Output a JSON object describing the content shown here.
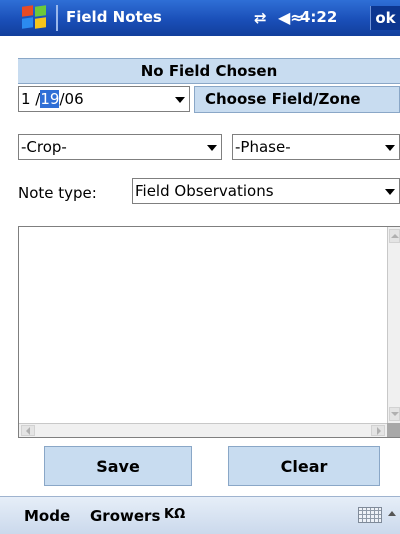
{
  "titlebar": {
    "app_title": "Field Notes",
    "connectivity_icon": "connectivity-icon",
    "volume_icon": "speaker-icon",
    "time": "4:22",
    "ok_label": "ok"
  },
  "header": {
    "field_name": "No Field Chosen"
  },
  "date": {
    "prefix": "1 /",
    "selected_day": "19",
    "suffix": "/06"
  },
  "choose_button": "Choose Field/Zone",
  "crop": {
    "value": "-Crop-"
  },
  "phase": {
    "value": "-Phase-"
  },
  "note_type": {
    "label": "Note type:",
    "value": "Field Observations"
  },
  "notes": {
    "text": ""
  },
  "buttons": {
    "save": "Save",
    "clear": "Clear"
  },
  "menubar": {
    "mode": "Mode",
    "growers": "Growers"
  },
  "colors": {
    "titlebar": "#1a4fb8",
    "panel": "#c8dcf0",
    "selection": "#2f6fd6"
  }
}
